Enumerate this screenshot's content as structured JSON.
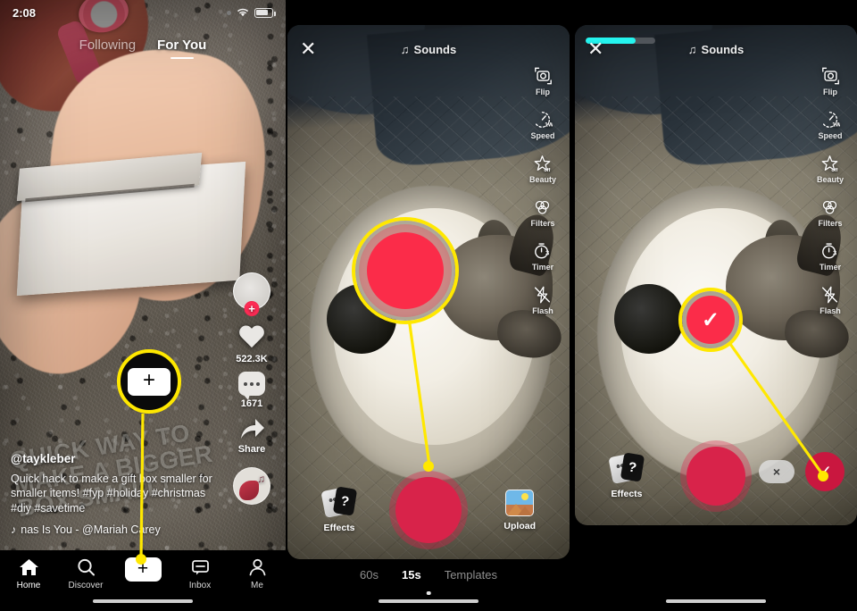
{
  "meta": {
    "accent_red": "#fe2c55",
    "accent_cyan": "#25f4ee",
    "highlight_yellow": "#ffe800",
    "record_red": "#d8234a"
  },
  "panel1": {
    "name": "tiktok-feed",
    "status_bar": {
      "time": "2:08",
      "wifi_icon": "wifi-icon",
      "battery_icon": "battery-icon"
    },
    "feed_tabs": [
      {
        "label": "Following",
        "active": false
      },
      {
        "label": "For You",
        "active": true
      }
    ],
    "side_rail": {
      "avatar": {
        "icon": "avatar",
        "follow_plus": "+"
      },
      "like": {
        "icon": "heart-icon",
        "count": "522.3K"
      },
      "comment": {
        "icon": "comment-icon",
        "count": "1671"
      },
      "share": {
        "icon": "share-icon",
        "label": "Share"
      },
      "sound_disc": {
        "icon": "music-disc-icon"
      }
    },
    "caption": {
      "username": "@taykleber",
      "text": "Quick hack to make a gift box smaller for smaller items! #fyp #holiday #christmas #diy #savetime",
      "music_note_icon": "music-note-icon",
      "music": "nas Is You - @Mariah Carey"
    },
    "video_overlay_text": "QUICK WAY TO MAKE A BIGGER BOX SMALL!",
    "tab_bar": [
      {
        "label": "Home",
        "icon": "home-icon",
        "active": true
      },
      {
        "label": "Discover",
        "icon": "search-icon",
        "active": false
      },
      {
        "label": "",
        "icon": "create-plus-icon",
        "active": false
      },
      {
        "label": "Inbox",
        "icon": "inbox-icon",
        "active": false
      },
      {
        "label": "Me",
        "icon": "person-icon",
        "active": false
      }
    ]
  },
  "panel2": {
    "name": "tiktok-camera-ready",
    "close_icon": "close-x-icon",
    "sounds": {
      "label": "Sounds",
      "icon": "music-note-icon"
    },
    "tools": [
      {
        "label": "Flip",
        "icon": "flip-camera-icon"
      },
      {
        "label": "Speed",
        "icon": "speed-gauge-icon",
        "badge": "1W"
      },
      {
        "label": "Beauty",
        "icon": "beauty-star-icon",
        "badge": "off"
      },
      {
        "label": "Filters",
        "icon": "filters-circles-icon"
      },
      {
        "label": "Timer",
        "icon": "timer-icon",
        "badge": "3"
      },
      {
        "label": "Flash",
        "icon": "flash-off-icon"
      }
    ],
    "effects": {
      "label": "Effects",
      "icon": "effects-cards-icon"
    },
    "record": {
      "label": "",
      "icon": "record-button"
    },
    "upload": {
      "label": "Upload",
      "icon": "photo-thumbnail-icon"
    },
    "modes": [
      {
        "label": "60s",
        "active": false
      },
      {
        "label": "15s",
        "active": true
      },
      {
        "label": "Templates",
        "active": false
      }
    ]
  },
  "panel3": {
    "name": "tiktok-camera-recorded",
    "close_icon": "close-x-icon",
    "sounds": {
      "label": "Sounds",
      "icon": "music-note-icon"
    },
    "recording_progress_percent": 72,
    "tools": [
      {
        "label": "Flip",
        "icon": "flip-camera-icon"
      },
      {
        "label": "Speed",
        "icon": "speed-gauge-icon",
        "badge": "1W"
      },
      {
        "label": "Beauty",
        "icon": "beauty-star-icon",
        "badge": "off"
      },
      {
        "label": "Filters",
        "icon": "filters-circles-icon"
      },
      {
        "label": "Timer",
        "icon": "timer-icon",
        "badge": "3"
      },
      {
        "label": "Flash",
        "icon": "flash-off-icon"
      }
    ],
    "effects": {
      "label": "Effects",
      "icon": "effects-cards-icon"
    },
    "record": {
      "label": "",
      "icon": "record-button"
    },
    "delete_clip": {
      "label": "×",
      "icon": "delete-x-icon"
    },
    "confirm": {
      "label": "✓",
      "icon": "check-icon"
    }
  },
  "annotations": {
    "step1": {
      "target": "create-plus-button",
      "magnified_glyph": "+"
    },
    "step2": {
      "target": "record-button",
      "magnified_glyph": ""
    },
    "step3": {
      "target": "confirm-check-button",
      "magnified_glyph": "✓"
    }
  }
}
